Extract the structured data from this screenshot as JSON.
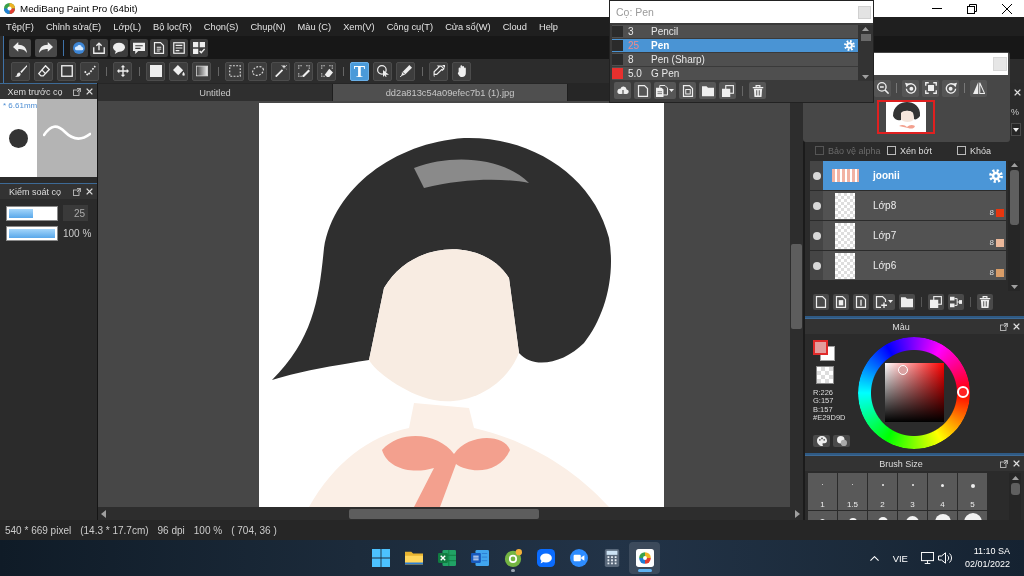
{
  "window": {
    "title": "MediBang Paint Pro (64bit)"
  },
  "menu": [
    "Tệp(F)",
    "Chỉnh sửa(E)",
    "Lớp(L)",
    "Bộ lọc(R)",
    "Chọn(S)",
    "Chụp(N)",
    "Màu (C)",
    "Xem(V)",
    "Công cụ(T)",
    "Cửa sổ(W)",
    "Cloud",
    "Help"
  ],
  "tools": [
    {
      "selected": false
    },
    {
      "selected": false
    },
    {
      "selected": false
    },
    {
      "selected": false
    },
    {
      "selected": false
    },
    {
      "selected": false
    },
    {
      "selected": false
    },
    {
      "selected": false
    },
    {
      "selected": false
    },
    {
      "selected": false
    },
    {
      "selected": false
    },
    {
      "selected": false
    },
    {
      "selected": false
    },
    {
      "selected": true,
      "glyph": "T"
    },
    {
      "selected": false
    },
    {
      "selected": false
    },
    {
      "selected": false
    },
    {
      "selected": false
    }
  ],
  "brush_popup": {
    "title": "Cọ: Pen",
    "brushes": [
      {
        "size": "3",
        "name": "Pencil",
        "color": "#2b2b2b",
        "selected": false
      },
      {
        "size": "25",
        "name": "Pen",
        "color": "#2b2b2b",
        "selected": true
      },
      {
        "size": "8",
        "name": "Pen (Sharp)",
        "color": "#2b2b2b",
        "selected": false
      },
      {
        "size": "5.0",
        "name": "G Pen",
        "color": "#e8302e",
        "selected": false
      }
    ]
  },
  "tabs": [
    {
      "label": "Untitled",
      "selected": false
    },
    {
      "label": "dd2a813c54a09efec7b1 (1).jpg",
      "selected": true
    }
  ],
  "brush_preview": {
    "title": "Xem trước cọ",
    "size": "* 6.61mm"
  },
  "brush_control": {
    "title": "Kiểm soát cọ",
    "sliders": [
      {
        "kind": "size",
        "level": 0.52,
        "reading": "25"
      },
      {
        "kind": "opacity",
        "level": 1,
        "reading": "100 %"
      }
    ]
  },
  "layers_panel": {
    "opacity": "%",
    "options": [
      {
        "label": "Bảo vệ alpha",
        "checked": false,
        "disabled": true
      },
      {
        "label": "Xén bớt",
        "checked": false,
        "disabled": false
      },
      {
        "label": "Khóa",
        "checked": false,
        "disabled": false
      }
    ],
    "layers": [
      {
        "name": "joonii",
        "kind": "folder",
        "selected": true
      },
      {
        "name": "Lớp8",
        "kind": "layer",
        "selected": false,
        "bit_depth": "8",
        "color": "#e8360e"
      },
      {
        "name": "Lớp7",
        "kind": "layer",
        "selected": false,
        "bit_depth": "8",
        "color": "#ebb89a"
      },
      {
        "name": "Lớp6",
        "kind": "layer",
        "selected": false,
        "bit_depth": "8",
        "color": "#d99d68"
      }
    ]
  },
  "color_panel": {
    "title": "Màu",
    "swatches": [
      {
        "color": "#e29d9d",
        "selected": true
      },
      {
        "color": "#ffffff",
        "selected": false
      }
    ],
    "readouts": [
      "R:226",
      "G:157",
      "B:157",
      "#E29D9D"
    ]
  },
  "brush_size_panel": {
    "title": "Brush Size",
    "sizes": [
      "1",
      "1.5",
      "2",
      "3",
      "4",
      "5"
    ]
  },
  "status_bar": [
    "540 * 669 pixel",
    "(14.3 * 17.7cm)",
    "96 dpi",
    "100 %",
    "( 704, 36 )"
  ],
  "taskbar": {
    "apps": [
      {
        "running": false,
        "selected": false
      },
      {
        "running": false,
        "selected": false
      },
      {
        "running": false,
        "selected": false
      },
      {
        "running": true,
        "selected": false
      },
      {
        "running": false,
        "selected": false
      },
      {
        "running": false,
        "selected": false
      },
      {
        "running": false,
        "selected": false
      },
      {
        "running": true,
        "selected": true
      }
    ],
    "language": "VIE",
    "time": "11:10 SA",
    "date": "02/01/2022"
  }
}
